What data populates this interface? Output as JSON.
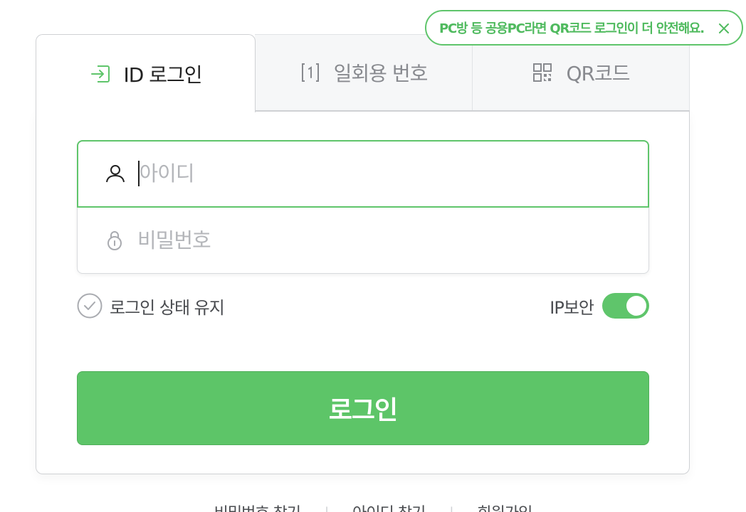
{
  "tooltip": {
    "text": "PC방 등 공용PC라면 QR코드 로그인이 더 안전해요.",
    "close_icon": "close-icon"
  },
  "tabs": [
    {
      "label": "ID 로그인",
      "icon": "login-arrow-icon",
      "active": true
    },
    {
      "label": "일회용 번호",
      "icon": "one-time-number-icon",
      "active": false
    },
    {
      "label": "QR코드",
      "icon": "qr-code-icon",
      "active": false
    }
  ],
  "form": {
    "id_placeholder": "아이디",
    "id_value": "",
    "pw_placeholder": "비밀번호",
    "pw_value": "",
    "keep_login_label": "로그인 상태 유지",
    "keep_login_checked": false,
    "ip_security_label": "IP보안",
    "ip_security_on": true,
    "login_button": "로그인"
  },
  "footer": {
    "links": [
      "비밀번호 찾기",
      "아이디 찾기",
      "회원가입"
    ],
    "separator": "|"
  },
  "colors": {
    "accent": "#5dc568",
    "accent_text": "#4fba5e"
  }
}
